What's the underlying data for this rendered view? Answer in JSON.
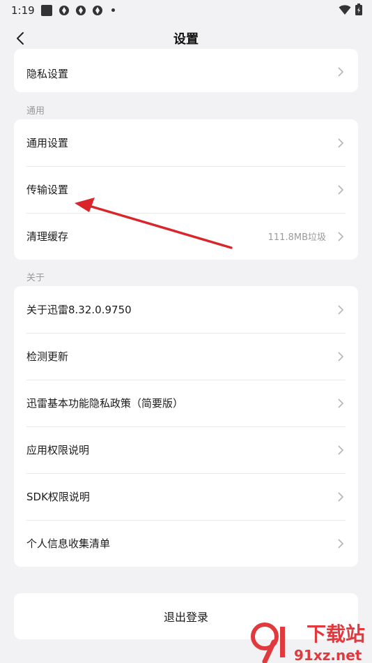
{
  "status_bar": {
    "time": "1:19"
  },
  "header": {
    "title": "设置"
  },
  "card_top": {
    "rows": [
      {
        "label": "隐私设置"
      }
    ]
  },
  "section_general": {
    "label": "通用",
    "rows": [
      {
        "label": "通用设置"
      },
      {
        "label": "传输设置"
      },
      {
        "label": "清理缓存",
        "value": "111.8MB垃圾"
      }
    ]
  },
  "section_about": {
    "label": "关于",
    "rows": [
      {
        "label": "关于迅雷8.32.0.9750"
      },
      {
        "label": "检测更新"
      },
      {
        "label": "迅雷基本功能隐私政策（简要版）"
      },
      {
        "label": "应用权限说明"
      },
      {
        "label": "SDK权限说明"
      },
      {
        "label": "个人信息收集清单"
      }
    ]
  },
  "logout": {
    "label": "退出登录"
  },
  "watermark": {
    "brand": "下载站",
    "domain": "91xz.net"
  },
  "colors": {
    "annotation_arrow": "#d9262a",
    "watermark_red": "#e03a3e"
  }
}
